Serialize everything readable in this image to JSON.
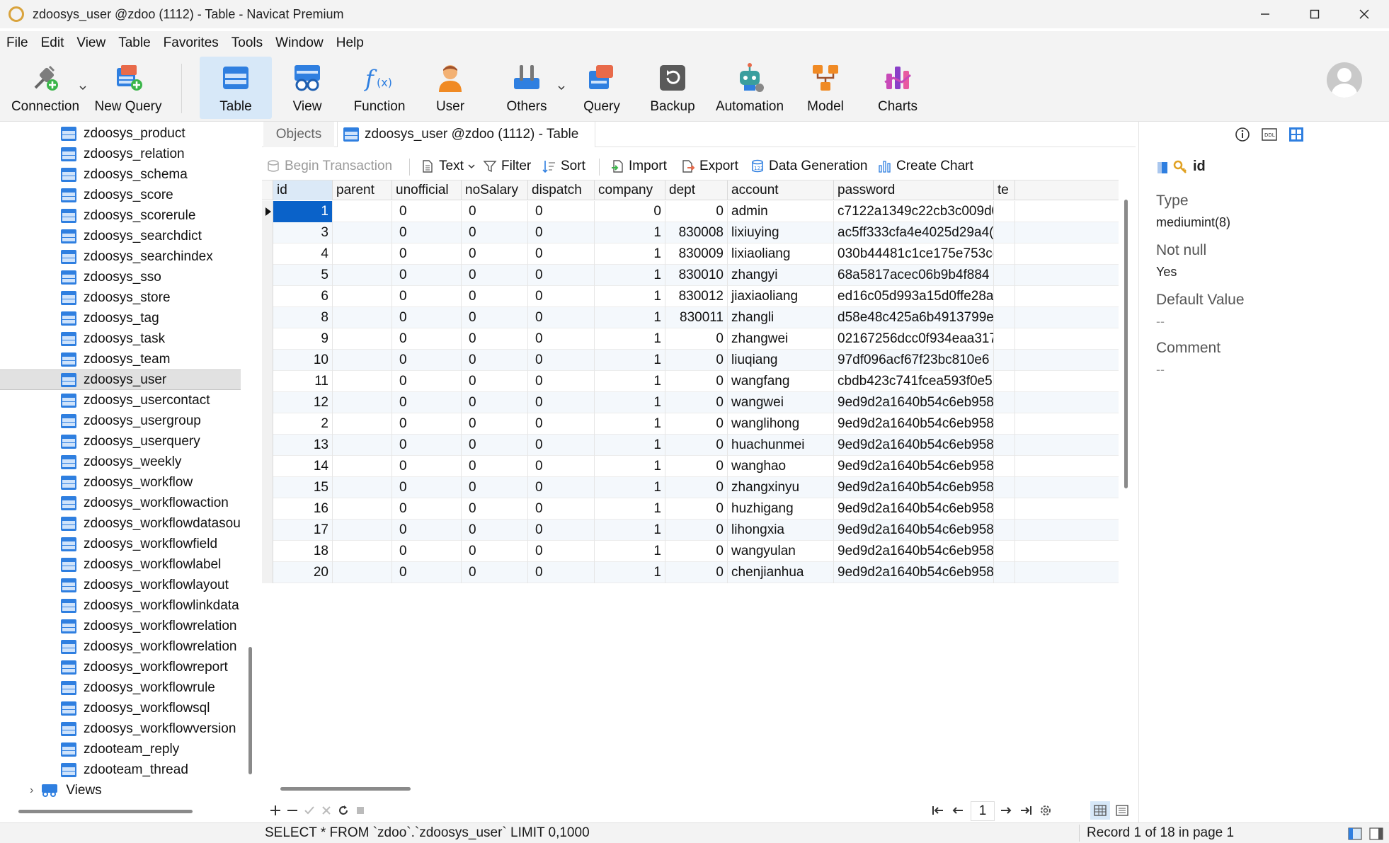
{
  "window": {
    "title": "zdoosys_user @zdoo (1112) - Table - Navicat Premium"
  },
  "menu": [
    "File",
    "Edit",
    "View",
    "Table",
    "Favorites",
    "Tools",
    "Window",
    "Help"
  ],
  "toolbar": {
    "connection": "Connection",
    "new_query": "New Query",
    "table": "Table",
    "view": "View",
    "function": "Function",
    "user": "User",
    "others": "Others",
    "query": "Query",
    "backup": "Backup",
    "automation": "Automation",
    "model": "Model",
    "charts": "Charts"
  },
  "sidebar": {
    "items": [
      "zdoosys_product",
      "zdoosys_relation",
      "zdoosys_schema",
      "zdoosys_score",
      "zdoosys_scorerule",
      "zdoosys_searchdict",
      "zdoosys_searchindex",
      "zdoosys_sso",
      "zdoosys_store",
      "zdoosys_tag",
      "zdoosys_task",
      "zdoosys_team",
      "zdoosys_user",
      "zdoosys_usercontact",
      "zdoosys_usergroup",
      "zdoosys_userquery",
      "zdoosys_weekly",
      "zdoosys_workflow",
      "zdoosys_workflowaction",
      "zdoosys_workflowdatasou",
      "zdoosys_workflowfield",
      "zdoosys_workflowlabel",
      "zdoosys_workflowlayout",
      "zdoosys_workflowlinkdata",
      "zdoosys_workflowrelation",
      "zdoosys_workflowrelation",
      "zdoosys_workflowreport",
      "zdoosys_workflowrule",
      "zdoosys_workflowsql",
      "zdoosys_workflowversion",
      "zdooteam_reply",
      "zdooteam_thread"
    ],
    "selected": "zdoosys_user",
    "views_label": "Views"
  },
  "tabs": {
    "objects": "Objects",
    "active": "zdoosys_user @zdoo (1112) - Table"
  },
  "subtoolbar": {
    "begin_transaction": "Begin Transaction",
    "text": "Text",
    "filter": "Filter",
    "sort": "Sort",
    "import": "Import",
    "export": "Export",
    "data_generation": "Data Generation",
    "create_chart": "Create Chart"
  },
  "grid": {
    "columns": [
      "id",
      "parent",
      "unofficial",
      "noSalary",
      "dispatch",
      "company",
      "dept",
      "account",
      "password",
      "te"
    ],
    "rows": [
      [
        "1",
        "",
        "0",
        "0",
        "0",
        "0",
        "0",
        "admin",
        "c7122a1349c22cb3c009d0"
      ],
      [
        "3",
        "",
        "0",
        "0",
        "0",
        "1",
        "830008",
        "lixiuying",
        "ac5ff333cfa4e4025d29a4("
      ],
      [
        "4",
        "",
        "0",
        "0",
        "0",
        "1",
        "830009",
        "lixiaoliang",
        "030b44481c1ce175e753ce"
      ],
      [
        "5",
        "",
        "0",
        "0",
        "0",
        "1",
        "830010",
        "zhangyi",
        "68a5817acec06b9b4f884"
      ],
      [
        "6",
        "",
        "0",
        "0",
        "0",
        "1",
        "830012",
        "jiaxiaoliang",
        "ed16c05d993a15d0ffe28a5"
      ],
      [
        "8",
        "",
        "0",
        "0",
        "0",
        "1",
        "830011",
        "zhangli",
        "d58e48c425a6b4913799e"
      ],
      [
        "9",
        "",
        "0",
        "0",
        "0",
        "1",
        "0",
        "zhangwei",
        "02167256dcc0f934eaa317b"
      ],
      [
        "10",
        "",
        "0",
        "0",
        "0",
        "1",
        "0",
        "liuqiang",
        "97df096acf67f23bc810e6"
      ],
      [
        "11",
        "",
        "0",
        "0",
        "0",
        "1",
        "0",
        "wangfang",
        "cbdb423c741fcea593f0e5"
      ],
      [
        "12",
        "",
        "0",
        "0",
        "0",
        "1",
        "0",
        "wangwei",
        "9ed9d2a1640b54c6eb958"
      ],
      [
        "2",
        "",
        "0",
        "0",
        "0",
        "1",
        "0",
        "wanglihong",
        "9ed9d2a1640b54c6eb958"
      ],
      [
        "13",
        "",
        "0",
        "0",
        "0",
        "1",
        "0",
        "huachunmei",
        "9ed9d2a1640b54c6eb958"
      ],
      [
        "14",
        "",
        "0",
        "0",
        "0",
        "1",
        "0",
        "wanghao",
        "9ed9d2a1640b54c6eb958"
      ],
      [
        "15",
        "",
        "0",
        "0",
        "0",
        "1",
        "0",
        "zhangxinyu",
        "9ed9d2a1640b54c6eb958"
      ],
      [
        "16",
        "",
        "0",
        "0",
        "0",
        "1",
        "0",
        "huzhigang",
        "9ed9d2a1640b54c6eb958"
      ],
      [
        "17",
        "",
        "0",
        "0",
        "0",
        "1",
        "0",
        "lihongxia",
        "9ed9d2a1640b54c6eb958"
      ],
      [
        "18",
        "",
        "0",
        "0",
        "0",
        "1",
        "0",
        "wangyulan",
        "9ed9d2a1640b54c6eb958"
      ],
      [
        "20",
        "",
        "0",
        "0",
        "0",
        "1",
        "0",
        "chenjianhua",
        "9ed9d2a1640b54c6eb958"
      ]
    ]
  },
  "pager": {
    "page": "1"
  },
  "status": {
    "sql": "SELECT * FROM `zdoo`.`zdoosys_user` LIMIT 0,1000",
    "record": "Record 1 of 18 in page 1"
  },
  "properties": {
    "field_name": "id",
    "type_label": "Type",
    "type_value": "mediumint(8)",
    "not_null_label": "Not null",
    "not_null_value": "Yes",
    "default_label": "Default Value",
    "default_value": "--",
    "comment_label": "Comment",
    "comment_value": "--"
  },
  "colors": {
    "accent": "#0a62c9",
    "table_icon": "#2f7fe0",
    "selection_bg": "#e1e1e1",
    "toolbar_active": "#d7e8f8"
  }
}
